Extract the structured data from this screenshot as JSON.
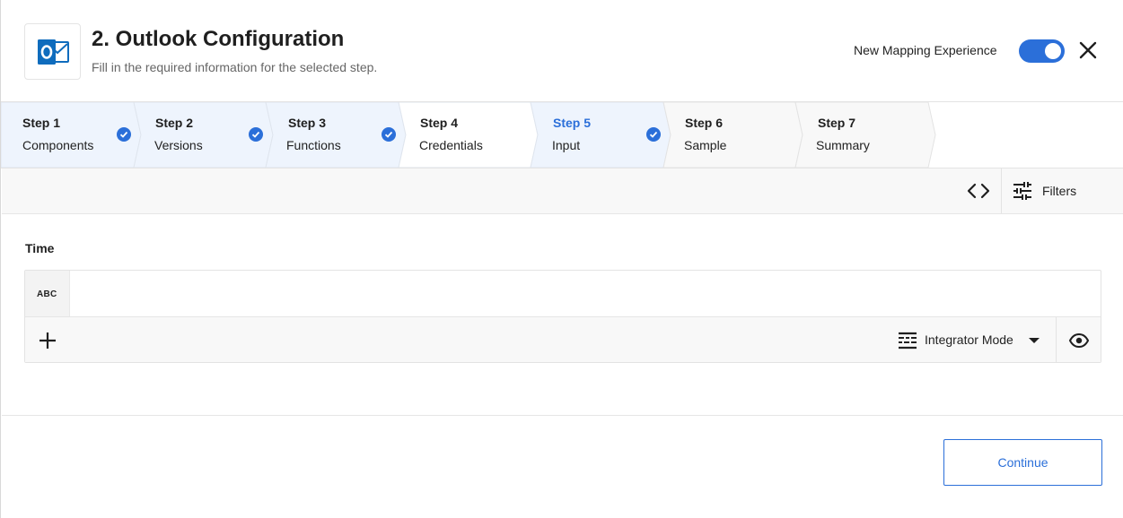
{
  "header": {
    "title": "2. Outlook Configuration",
    "subtitle": "Fill in the required information for the selected step.",
    "app_icon": "outlook-icon",
    "toggle_label": "New Mapping Experience",
    "toggle_on": true,
    "close_icon": "close-icon"
  },
  "steps": [
    {
      "number": "Step 1",
      "name": "Components",
      "completed": true,
      "active": false
    },
    {
      "number": "Step 2",
      "name": "Versions",
      "completed": true,
      "active": false
    },
    {
      "number": "Step 3",
      "name": "Functions",
      "completed": true,
      "active": false
    },
    {
      "number": "Step 4",
      "name": "Credentials",
      "completed": false,
      "active": false
    },
    {
      "number": "Step 5",
      "name": "Input",
      "completed": true,
      "active": true
    },
    {
      "number": "Step 6",
      "name": "Sample",
      "completed": false,
      "active": false
    },
    {
      "number": "Step 7",
      "name": "Summary",
      "completed": false,
      "active": false
    }
  ],
  "toolbar": {
    "code_icon": "code-icon",
    "filters_icon": "sliders-icon",
    "filters_label": "Filters"
  },
  "field": {
    "label": "Time",
    "type_chip": "ABC",
    "value": "",
    "add_icon": "plus-icon",
    "mode_icon": "lines-icon",
    "mode_label": "Integrator Mode",
    "eye_icon": "eye-icon"
  },
  "footer": {
    "continue_label": "Continue"
  },
  "colors": {
    "accent": "#2b6fd9",
    "completed_step_bg": "#eef4fd",
    "default_step_bg": "#f8f8f8",
    "current_step_bg": "#ffffff"
  }
}
